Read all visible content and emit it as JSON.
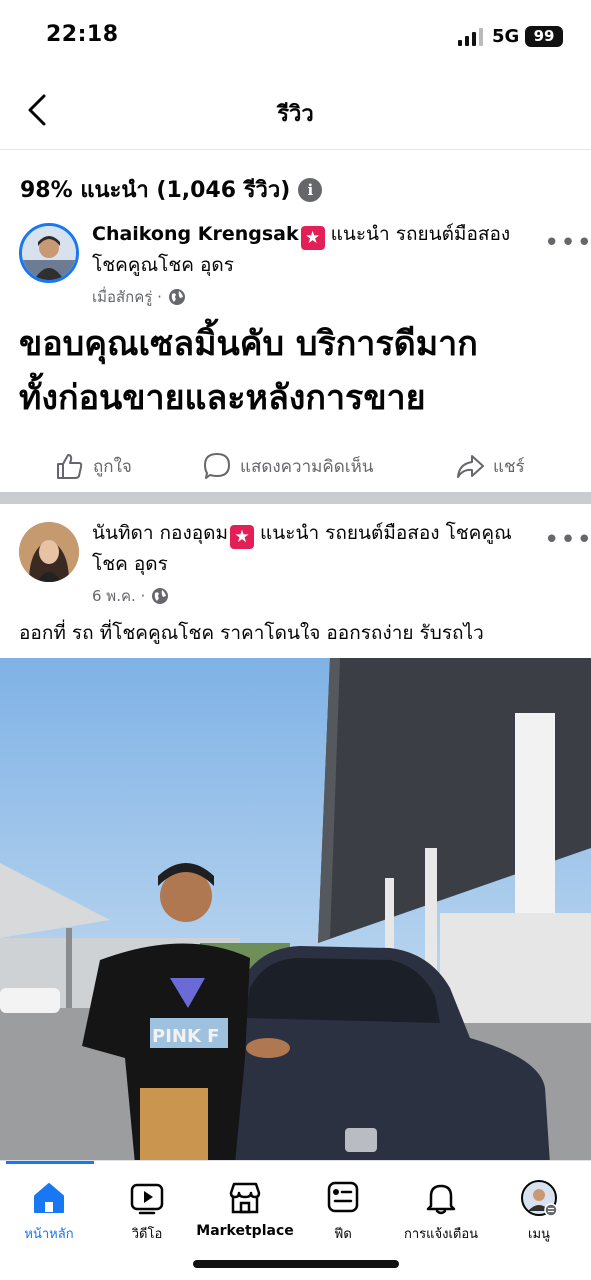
{
  "status_bar": {
    "time": "22:18",
    "network": "5G",
    "battery": "99"
  },
  "header": {
    "title": "รีวิว"
  },
  "summary": {
    "text": "98% แนะนำ (1,046 รีวิว)",
    "info_icon": "info-icon"
  },
  "posts": [
    {
      "author": "Chaikong Krengsak",
      "recommendation": "แนะนำ รถยนต์มือสอง โชคคูณโชค อุดร",
      "time": "เมื่อสักครู่",
      "body_line1": "ขอบคุณเซลมิ้นคับ บริการดีมาก",
      "body_line2": "ทั้งก่อนขายและหลังการขาย",
      "actions": {
        "like": "ถูกใจ",
        "comment": "แสดงความคิดเห็น",
        "share": "แชร์"
      }
    },
    {
      "author": "นันทิดา กองอุดม",
      "recommendation": "แนะนำ รถยนต์มือสอง โชคคูณโชค อุดร",
      "time": "6 พ.ค.",
      "body": "ออกที่ รถ ที่โชคคูณโชค ราคาโดนใจ ออกรถง่าย รับรถไว"
    }
  ],
  "tabbar": {
    "tabs": [
      {
        "label": "หน้าหลัก",
        "icon": "home-icon",
        "active": true
      },
      {
        "label": "วิดีโอ",
        "icon": "video-icon"
      },
      {
        "label": "Marketplace",
        "icon": "marketplace-icon"
      },
      {
        "label": "ฟีด",
        "icon": "feed-icon"
      },
      {
        "label": "การแจ้งเตือน",
        "icon": "bell-icon"
      },
      {
        "label": "เมนู",
        "icon": "menu-avatar-icon"
      }
    ]
  },
  "colors": {
    "accent": "#1877f2",
    "badge": "#e41e57",
    "secondary_text": "#65676b"
  }
}
